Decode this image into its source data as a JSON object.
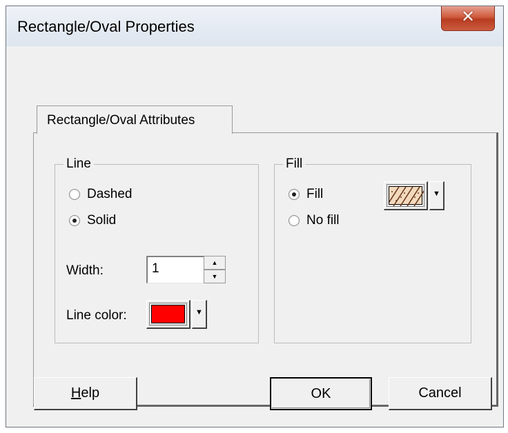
{
  "window": {
    "title": "Rectangle/Oval Properties",
    "close_glyph": "✕"
  },
  "tabs": [
    {
      "label": "Rectangle/Oval Attributes",
      "selected": true
    }
  ],
  "line_group": {
    "title": "Line",
    "style_options": [
      {
        "label": "Dashed",
        "checked": false
      },
      {
        "label": "Solid",
        "checked": true
      }
    ],
    "width_label": "Width:",
    "width_value": "1",
    "color_label": "Line color:",
    "color": "#ff0000"
  },
  "fill_group": {
    "title": "Fill",
    "options": [
      {
        "label": "Fill",
        "checked": true
      },
      {
        "label": "No fill",
        "checked": false
      }
    ],
    "pattern_icon": "diagonal-hatch-pattern-icon"
  },
  "buttons": {
    "help": "Help",
    "help_mnemonic": "H",
    "help_rest": "elp",
    "ok": "OK",
    "cancel": "Cancel"
  },
  "icons": {
    "spin_up": "▲",
    "spin_down": "▼",
    "dropdown": "▼"
  },
  "colors": {
    "dialog_bg": "#f0f0f0",
    "title_text": "#000000",
    "close_button": "#c7432a"
  }
}
